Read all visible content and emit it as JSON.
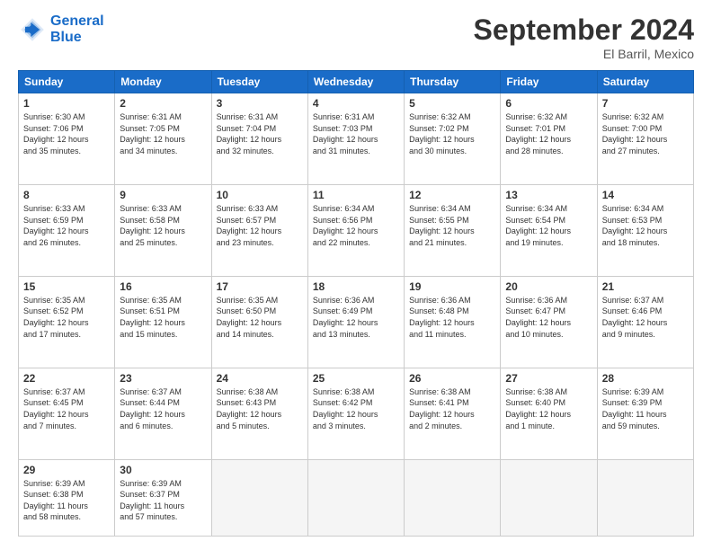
{
  "header": {
    "logo_line1": "General",
    "logo_line2": "Blue",
    "month": "September 2024",
    "location": "El Barril, Mexico"
  },
  "weekdays": [
    "Sunday",
    "Monday",
    "Tuesday",
    "Wednesday",
    "Thursday",
    "Friday",
    "Saturday"
  ],
  "weeks": [
    [
      {
        "day": "1",
        "info": "Sunrise: 6:30 AM\nSunset: 7:06 PM\nDaylight: 12 hours\nand 35 minutes."
      },
      {
        "day": "2",
        "info": "Sunrise: 6:31 AM\nSunset: 7:05 PM\nDaylight: 12 hours\nand 34 minutes."
      },
      {
        "day": "3",
        "info": "Sunrise: 6:31 AM\nSunset: 7:04 PM\nDaylight: 12 hours\nand 32 minutes."
      },
      {
        "day": "4",
        "info": "Sunrise: 6:31 AM\nSunset: 7:03 PM\nDaylight: 12 hours\nand 31 minutes."
      },
      {
        "day": "5",
        "info": "Sunrise: 6:32 AM\nSunset: 7:02 PM\nDaylight: 12 hours\nand 30 minutes."
      },
      {
        "day": "6",
        "info": "Sunrise: 6:32 AM\nSunset: 7:01 PM\nDaylight: 12 hours\nand 28 minutes."
      },
      {
        "day": "7",
        "info": "Sunrise: 6:32 AM\nSunset: 7:00 PM\nDaylight: 12 hours\nand 27 minutes."
      }
    ],
    [
      {
        "day": "8",
        "info": "Sunrise: 6:33 AM\nSunset: 6:59 PM\nDaylight: 12 hours\nand 26 minutes."
      },
      {
        "day": "9",
        "info": "Sunrise: 6:33 AM\nSunset: 6:58 PM\nDaylight: 12 hours\nand 25 minutes."
      },
      {
        "day": "10",
        "info": "Sunrise: 6:33 AM\nSunset: 6:57 PM\nDaylight: 12 hours\nand 23 minutes."
      },
      {
        "day": "11",
        "info": "Sunrise: 6:34 AM\nSunset: 6:56 PM\nDaylight: 12 hours\nand 22 minutes."
      },
      {
        "day": "12",
        "info": "Sunrise: 6:34 AM\nSunset: 6:55 PM\nDaylight: 12 hours\nand 21 minutes."
      },
      {
        "day": "13",
        "info": "Sunrise: 6:34 AM\nSunset: 6:54 PM\nDaylight: 12 hours\nand 19 minutes."
      },
      {
        "day": "14",
        "info": "Sunrise: 6:34 AM\nSunset: 6:53 PM\nDaylight: 12 hours\nand 18 minutes."
      }
    ],
    [
      {
        "day": "15",
        "info": "Sunrise: 6:35 AM\nSunset: 6:52 PM\nDaylight: 12 hours\nand 17 minutes."
      },
      {
        "day": "16",
        "info": "Sunrise: 6:35 AM\nSunset: 6:51 PM\nDaylight: 12 hours\nand 15 minutes."
      },
      {
        "day": "17",
        "info": "Sunrise: 6:35 AM\nSunset: 6:50 PM\nDaylight: 12 hours\nand 14 minutes."
      },
      {
        "day": "18",
        "info": "Sunrise: 6:36 AM\nSunset: 6:49 PM\nDaylight: 12 hours\nand 13 minutes."
      },
      {
        "day": "19",
        "info": "Sunrise: 6:36 AM\nSunset: 6:48 PM\nDaylight: 12 hours\nand 11 minutes."
      },
      {
        "day": "20",
        "info": "Sunrise: 6:36 AM\nSunset: 6:47 PM\nDaylight: 12 hours\nand 10 minutes."
      },
      {
        "day": "21",
        "info": "Sunrise: 6:37 AM\nSunset: 6:46 PM\nDaylight: 12 hours\nand 9 minutes."
      }
    ],
    [
      {
        "day": "22",
        "info": "Sunrise: 6:37 AM\nSunset: 6:45 PM\nDaylight: 12 hours\nand 7 minutes."
      },
      {
        "day": "23",
        "info": "Sunrise: 6:37 AM\nSunset: 6:44 PM\nDaylight: 12 hours\nand 6 minutes."
      },
      {
        "day": "24",
        "info": "Sunrise: 6:38 AM\nSunset: 6:43 PM\nDaylight: 12 hours\nand 5 minutes."
      },
      {
        "day": "25",
        "info": "Sunrise: 6:38 AM\nSunset: 6:42 PM\nDaylight: 12 hours\nand 3 minutes."
      },
      {
        "day": "26",
        "info": "Sunrise: 6:38 AM\nSunset: 6:41 PM\nDaylight: 12 hours\nand 2 minutes."
      },
      {
        "day": "27",
        "info": "Sunrise: 6:38 AM\nSunset: 6:40 PM\nDaylight: 12 hours\nand 1 minute."
      },
      {
        "day": "28",
        "info": "Sunrise: 6:39 AM\nSunset: 6:39 PM\nDaylight: 11 hours\nand 59 minutes."
      }
    ],
    [
      {
        "day": "29",
        "info": "Sunrise: 6:39 AM\nSunset: 6:38 PM\nDaylight: 11 hours\nand 58 minutes."
      },
      {
        "day": "30",
        "info": "Sunrise: 6:39 AM\nSunset: 6:37 PM\nDaylight: 11 hours\nand 57 minutes."
      },
      {
        "day": "",
        "info": ""
      },
      {
        "day": "",
        "info": ""
      },
      {
        "day": "",
        "info": ""
      },
      {
        "day": "",
        "info": ""
      },
      {
        "day": "",
        "info": ""
      }
    ]
  ]
}
